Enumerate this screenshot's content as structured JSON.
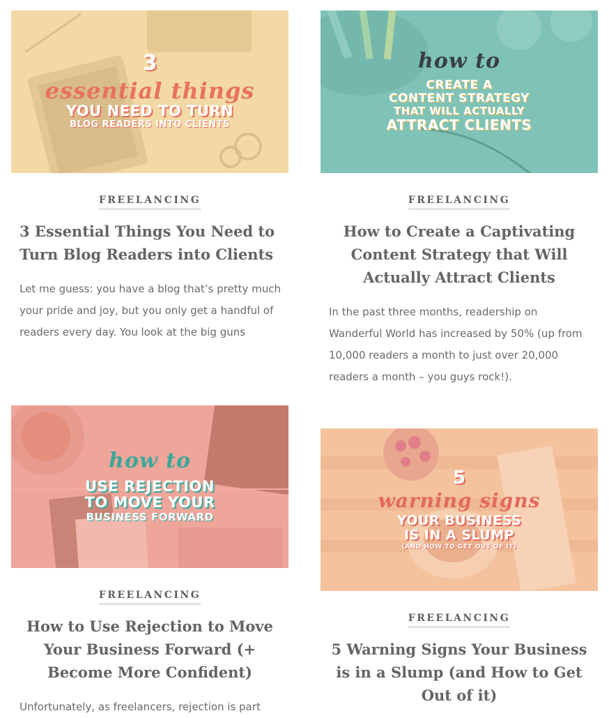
{
  "posts": [
    {
      "category": "FREELANCING",
      "title": "3 Essential Things You Need to Turn Blog Readers into Clients",
      "excerpt": "Let me guess: you have a blog that’s pretty much your pride and joy, but you only get a handful of readers every day. You look at the big guns",
      "image": {
        "bg_color": "#f2d9a6",
        "number": "3",
        "script_text": "essential things",
        "script_color": "#e8725a",
        "lines": [
          "YOU NEED TO TURN",
          "BLOG READERS INTO CLIENTS"
        ]
      }
    },
    {
      "category": "FREELANCING",
      "title": "How to Create a Captivating Content Strategy that Will Actually Attract Clients",
      "excerpt": "In the past three months, readership on Wanderful World has increased by 50% (up from 10,000 readers a month to just over 20,000 readers a month – you guys rock!).",
      "image": {
        "bg_color": "#7fc3b8",
        "script_text": "how to",
        "script_color": "#3a3f45",
        "lines": [
          "CREATE A",
          "CONTENT STRATEGY",
          "THAT WILL ACTUALLY",
          "ATTRACT CLIENTS"
        ]
      }
    },
    {
      "category": "FREELANCING",
      "title": "How to Use Rejection to Move Your Business Forward (+ Become More Confident)",
      "excerpt": "Unfortunately, as freelancers, rejection is part",
      "image": {
        "bg_color": "#eea59a",
        "script_text": "how to",
        "script_color": "#3aa89a",
        "lines": [
          "USE REJECTION",
          "TO MOVE YOUR",
          "BUSINESS FORWARD"
        ]
      }
    },
    {
      "category": "FREELANCING",
      "title": "5 Warning Signs Your Business is in a Slump (and How to Get Out of it)",
      "excerpt": "",
      "image": {
        "bg_color": "#f4c39e",
        "number": "5",
        "script_text": "warning signs",
        "script_color": "#e36a5c",
        "lines": [
          "YOUR BUSINESS",
          "IS IN A SLUMP",
          "(AND HOW TO GET OUT OF IT)"
        ]
      }
    }
  ]
}
